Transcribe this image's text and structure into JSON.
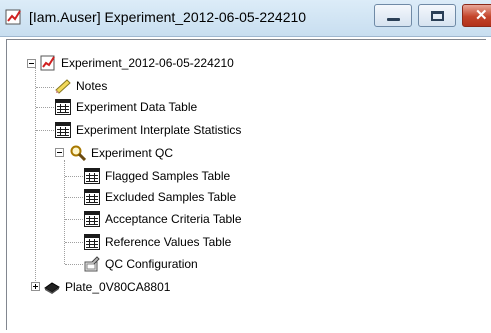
{
  "window": {
    "title": "[Iam.Auser] Experiment_2012-06-05-224210",
    "minimize_glyph": "",
    "close_glyph": "✕"
  },
  "tree": {
    "root": {
      "label": "Experiment_2012-06-05-224210",
      "icon": "experiment-icon",
      "expanded": true
    },
    "items": [
      {
        "label": "Notes",
        "icon": "notes-pencil-icon"
      },
      {
        "label": "Experiment Data Table",
        "icon": "table-icon"
      },
      {
        "label": "Experiment Interplate Statistics",
        "icon": "table-icon"
      },
      {
        "label": "Experiment QC",
        "icon": "magnifier-icon",
        "expanded": true,
        "children": [
          {
            "label": "Flagged Samples Table",
            "icon": "table-icon"
          },
          {
            "label": "Excluded Samples Table",
            "icon": "table-icon"
          },
          {
            "label": "Acceptance Criteria Table",
            "icon": "table-icon"
          },
          {
            "label": "Reference Values Table",
            "icon": "table-icon"
          },
          {
            "label": "QC Configuration",
            "icon": "configuration-icon"
          }
        ]
      },
      {
        "label": "Plate_0V80CA8801",
        "icon": "plate-icon",
        "expanded": false
      }
    ]
  }
}
